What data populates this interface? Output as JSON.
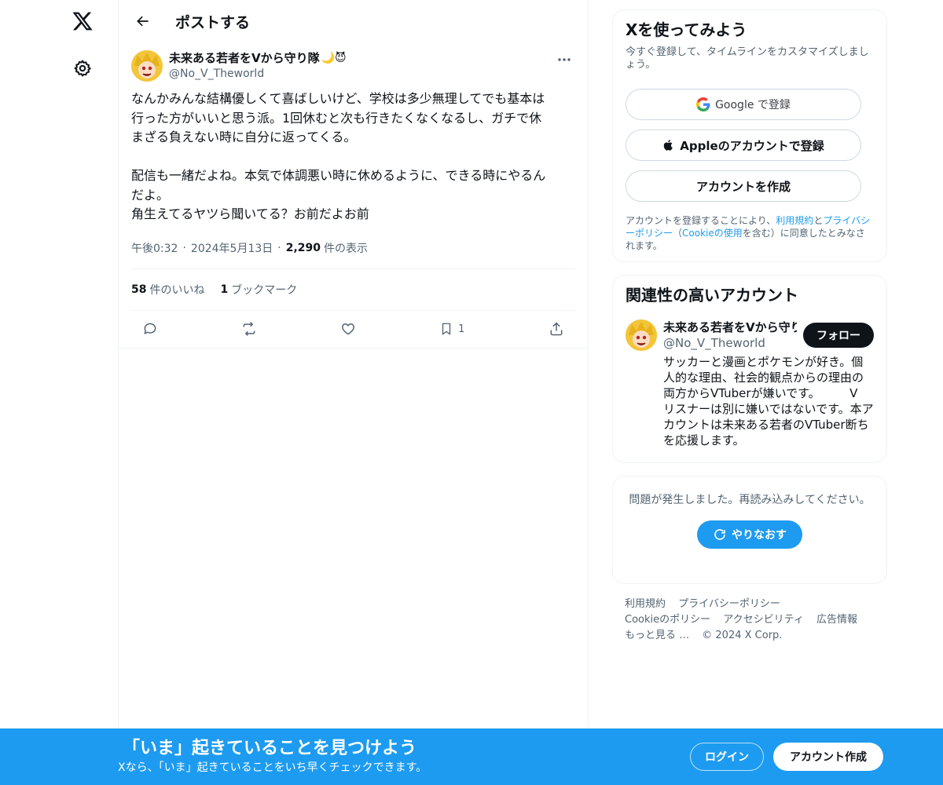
{
  "header": {
    "title": "ポストする"
  },
  "tweet": {
    "author_name": "未来ある若者をVから守り隊",
    "author_emoji": "🌙😈",
    "author_handle": "@No_V_Theworld",
    "text": "なんかみんな結構優しくて喜ばしいけど、学校は多少無理してでも基本は\n行った方がいいと思う派。1回休むと次も行きたくなくなるし、ガチで休\nまざる負えない時に自分に返ってくる。\n\n配信も一緒だよね。本気で体調悪い時に休めるように、できる時にやるん\nだよ。\n角生えてるヤツら聞いてる？お前だよお前",
    "time": "午後0:32",
    "date": "2024年5月13日",
    "views_count": "2,290",
    "views_label": "件の表示",
    "likes_count": "58",
    "likes_label": "件のいいね",
    "bookmarks_count": "1",
    "bookmarks_label": "ブックマーク",
    "bookmark_action_count": "1"
  },
  "signup": {
    "title": "Xを使ってみよう",
    "subtitle": "今すぐ登録して、タイムラインをカスタマイズしましょう。",
    "google_label": "Google で登録",
    "apple_label": "Appleのアカウントで登録",
    "create_label": "アカウントを作成",
    "terms_prefix": "アカウントを登録することにより、",
    "terms_link": "利用規約",
    "terms_and": "と",
    "privacy_link": "プライバシーポリシー",
    "cookie_open": "（",
    "cookie_link": "Cookieの使用",
    "cookie_suffix": "を含む）に同意したとみなされます。"
  },
  "related": {
    "title": "関連性の高いアカウント",
    "name": "未来ある若者をVから守り隊",
    "handle": "@No_V_Theworld",
    "follow_label": "フォロー",
    "bio": "サッカーと漫画とポケモンが好き。個\n人的な理由、社会的観点からの理由の\n両方からVTuberが嫌いです。　　　V\nリスナーは別に嫌いではないです。本ア\nカウントは未来ある若者のVTuber断ち\nを応援します。"
  },
  "error": {
    "text": "問題が発生しました。再読み込みしてください。",
    "retry_label": "やりなおす"
  },
  "footer": {
    "links": [
      "利用規約",
      "プライバシーポリシー",
      "Cookieのポリシー",
      "アクセシビリティ",
      "広告情報",
      "もっと見る …"
    ],
    "copyright": "© 2024 X Corp."
  },
  "banner": {
    "title": "「いま」起きていることを見つけよう",
    "subtitle": "Xなら、「いま」起きていることをいち早くチェックできます。",
    "login_label": "ログイン",
    "signup_label": "アカウント作成"
  },
  "icons": {
    "logo": "x-logo-icon",
    "settings": "gear-icon",
    "back": "arrow-left-icon",
    "more": "more-horizontal-icon",
    "reply": "reply-icon",
    "repost": "repost-icon",
    "like": "heart-icon",
    "bookmark": "bookmark-icon",
    "share": "share-icon",
    "google": "google-g-icon",
    "apple": "apple-icon",
    "retry": "refresh-icon"
  },
  "colors": {
    "accent": "#1d9bf0",
    "text": "#0f1419",
    "muted": "#536471",
    "border": "#eff3f4"
  }
}
